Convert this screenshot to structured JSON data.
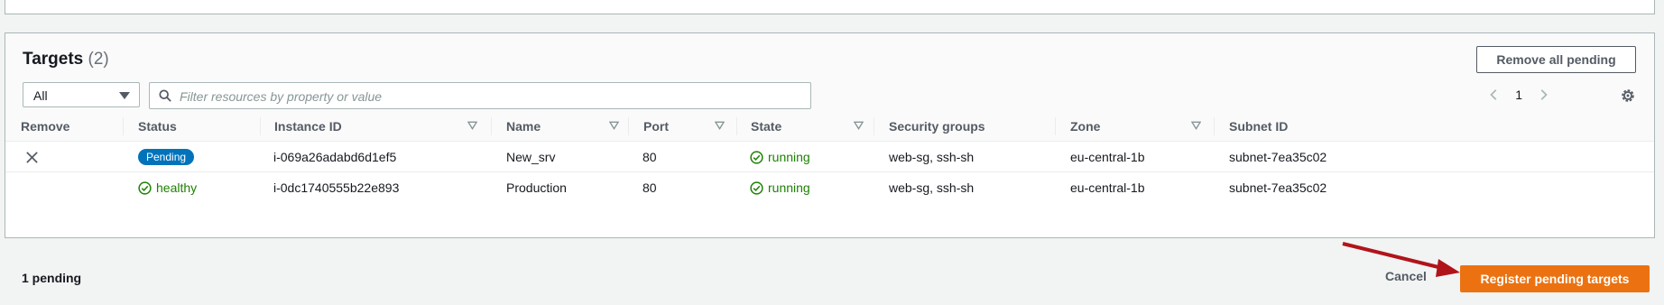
{
  "panel": {
    "title": "Targets",
    "count": "(2)",
    "remove_all_label": "Remove all pending",
    "filter_select": "All",
    "search_placeholder": "Filter resources by property or value",
    "page_number": "1"
  },
  "table": {
    "headers": {
      "remove": "Remove",
      "status": "Status",
      "instance_id": "Instance ID",
      "name": "Name",
      "port": "Port",
      "state": "State",
      "security_groups": "Security groups",
      "zone": "Zone",
      "subnet_id": "Subnet ID"
    },
    "rows": [
      {
        "status": "Pending",
        "status_type": "badge",
        "instance_id": "i-069a26adabd6d1ef5",
        "name": "New_srv",
        "port": "80",
        "state": "running",
        "security_groups": "web-sg, ssh-sh",
        "zone": "eu-central-1b",
        "subnet_id": "subnet-7ea35c02",
        "removable": true
      },
      {
        "status": "healthy",
        "status_type": "ok",
        "instance_id": "i-0dc1740555b22e893",
        "name": "Production",
        "port": "80",
        "state": "running",
        "security_groups": "web-sg, ssh-sh",
        "zone": "eu-central-1b",
        "subnet_id": "subnet-7ea35c02",
        "removable": false
      }
    ]
  },
  "footer": {
    "pending_text": "1 pending",
    "cancel_label": "Cancel",
    "register_label": "Register pending targets"
  },
  "colors": {
    "primary_button": "#ec7211",
    "badge": "#0073bb",
    "success": "#1d8102",
    "annotation_arrow": "#b0141a"
  }
}
